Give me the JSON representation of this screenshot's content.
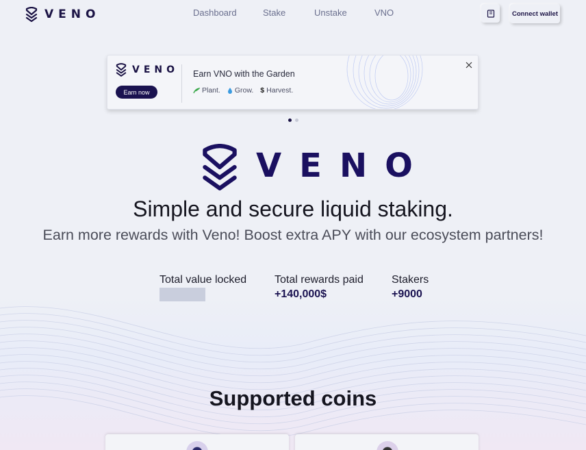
{
  "header": {
    "logo_text": "VENO",
    "nav": [
      "Dashboard",
      "Stake",
      "Unstake",
      "VNO"
    ],
    "connect_label": "Connect wallet"
  },
  "banner": {
    "logo_text": "VENO",
    "cta_label": "Earn now",
    "title": "Earn VNO with the Garden",
    "tagline": [
      {
        "icon": "sprout-icon",
        "text": "Plant."
      },
      {
        "icon": "droplet-icon",
        "text": "Grow."
      },
      {
        "icon": "dollar-icon",
        "text": "Harvest."
      }
    ],
    "carousel": {
      "total": 2,
      "active": 0
    }
  },
  "hero": {
    "logo_text": "VENO",
    "headline": "Simple and secure liquid staking.",
    "subline": "Earn more rewards with Veno! Boost extra APY with our ecosystem partners!"
  },
  "stats": {
    "tvl_label": "Total value locked",
    "rewards_label": "Total rewards paid",
    "rewards_value": "+140,000$",
    "stakers_label": "Stakers",
    "stakers_value": "+9000"
  },
  "coins": {
    "title": "Supported coins"
  },
  "colors": {
    "brand": "#1a1250",
    "background": "#eef0f6"
  }
}
